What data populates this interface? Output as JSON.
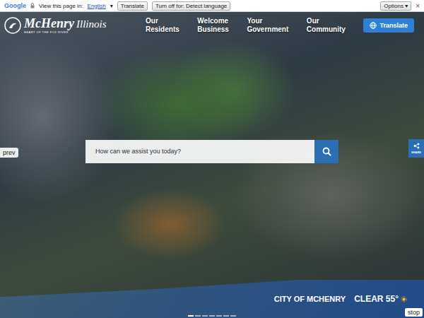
{
  "translate_bar": {
    "brand": "Google",
    "prompt": "View this page in:",
    "language": "English",
    "language_arrow": "▾",
    "translate_button": "Translate",
    "turn_off_button": "Turn off for: Detect language",
    "options_button": "Options ▾",
    "close": "×"
  },
  "header": {
    "logo": {
      "name": "McHenry",
      "state": "Illinois",
      "tagline": "HEART OF THE FOX RIVER"
    },
    "nav": [
      {
        "lines": [
          "Our",
          "Residents"
        ]
      },
      {
        "lines": [
          "Welcome",
          "Business"
        ]
      },
      {
        "lines": [
          "Your",
          "Government"
        ]
      },
      {
        "lines": [
          "Our",
          "Community"
        ]
      }
    ],
    "translate_button": "Translate"
  },
  "hero": {
    "search_placeholder": "How can we assist you today?",
    "prev_button": "prev",
    "share_button": "SHARE",
    "stop_button": "stop",
    "slide_dots": [
      {
        "selected": true
      },
      {
        "selected": false
      },
      {
        "selected": false
      },
      {
        "selected": false
      },
      {
        "selected": false
      },
      {
        "selected": false
      },
      {
        "selected": false
      }
    ]
  },
  "footer_bar": {
    "city": "CITY OF MCHENRY",
    "weather": "CLEAR 55°"
  }
}
